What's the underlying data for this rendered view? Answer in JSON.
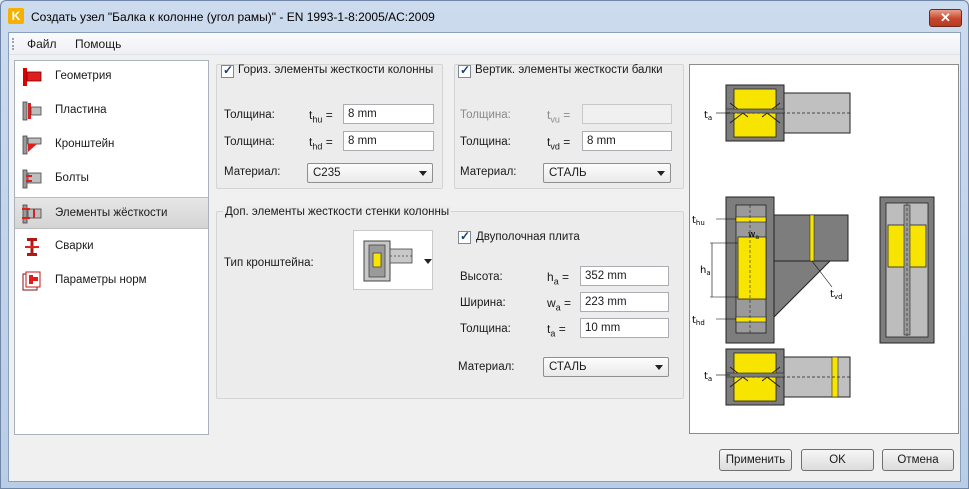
{
  "window": {
    "icon_letter": "K",
    "title": "Создать узел \"Балка к колонне (угол рамы)\" - EN 1993-1-8:2005/AC:2009",
    "close_symbol": "✕"
  },
  "menu": {
    "file": "Файл",
    "help": "Помощь"
  },
  "sidebar": {
    "items": [
      {
        "label": "Геометрия"
      },
      {
        "label": "Пластина"
      },
      {
        "label": "Кронштейн"
      },
      {
        "label": "Болты"
      },
      {
        "label": "Элементы жёсткости",
        "selected": true
      },
      {
        "label": "Сварки"
      },
      {
        "label": "Параметры норм"
      }
    ]
  },
  "column_stiffeners": {
    "title": "Гориз. элементы жесткости колонны",
    "checked": true,
    "thickness_upper": {
      "label": "Толщина:",
      "symbol": "t",
      "sub": "hu",
      "eq": "=",
      "value": "8 mm"
    },
    "thickness_lower": {
      "label": "Толщина:",
      "symbol": "t",
      "sub": "hd",
      "eq": "=",
      "value": "8 mm"
    },
    "material": {
      "label": "Материал:",
      "value": "C235"
    }
  },
  "beam_stiffeners": {
    "title": "Вертик. элементы жесткости балки",
    "checked": true,
    "thickness_upper": {
      "label": "Толщина:",
      "symbol": "t",
      "sub": "vu",
      "eq": "=",
      "value": ""
    },
    "thickness_lower": {
      "label": "Толщина:",
      "symbol": "t",
      "sub": "vd",
      "eq": "=",
      "value": "8 mm"
    },
    "material": {
      "label": "Материал:",
      "value": "СТАЛЬ"
    }
  },
  "web_stiffeners": {
    "title": "Доп. элементы жесткости стенки колонны",
    "bracket_type_label": "Тип кронштейна:",
    "double_flange": {
      "label": "Двуполочная плита",
      "checked": true
    },
    "height": {
      "label": "Высота:",
      "symbol": "h",
      "sub": "a",
      "eq": "=",
      "value": "352 mm"
    },
    "width": {
      "label": "Ширина:",
      "symbol": "w",
      "sub": "a",
      "eq": "=",
      "value": "223 mm"
    },
    "thickness": {
      "label": "Толщина:",
      "symbol": "t",
      "sub": "a",
      "eq": "=",
      "value": "10 mm"
    },
    "material": {
      "label": "Материал:",
      "value": "СТАЛЬ"
    }
  },
  "preview_labels": {
    "ta_top": "t",
    "ta_top_sub": "a",
    "thu": "t",
    "thu_sub": "hu",
    "wa": "w",
    "wa_sub": "a",
    "ha": "h",
    "ha_sub": "a",
    "thd": "t",
    "thd_sub": "hd",
    "tvd": "t",
    "tvd_sub": "vd",
    "ta_bottom": "t",
    "ta_bottom_sub": "a"
  },
  "buttons": {
    "apply": "Применить",
    "ok": "OK",
    "cancel": "Отмена"
  },
  "colors": {
    "steel": "#7d7d7d",
    "stiffener": "#f7e400",
    "selected": "#d6d6d6",
    "accent_red": "#e11e1e"
  }
}
